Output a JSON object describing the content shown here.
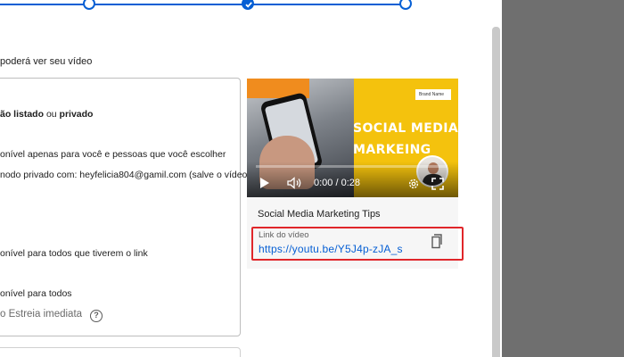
{
  "visibility": {
    "subtitle": "poderá ver seu vídeo",
    "private_heading_a": "ão listado",
    "private_heading_or": "ou",
    "private_heading_b": "privado",
    "private_desc": "onível apenas para você e pessoas que você escolher",
    "private_share": "nodo privado com: heyfelicia804@gamil.com (salve o vídeo",
    "unlisted_desc": "onível para todos que tiverem o link",
    "public_desc": "onível para todos",
    "premiere_label": "o Estreia imediata",
    "help_glyph": "?"
  },
  "preview": {
    "thumbnail_line1": "SOCIAL MEDIA",
    "thumbnail_line2": "MARKEING",
    "brand_label": "Brand Name",
    "time": "0:00 / 0:28",
    "progress_fraction": 0.0,
    "video_title": "Social Media Marketing Tips",
    "link_label": "Link do vídeo",
    "link_url": "https://youtu.be/Y5J4p-zJA_s"
  },
  "colors": {
    "accent": "#065fd4",
    "highlight_box": "#e0262a",
    "thumbnail_yellow": "#f4c20d",
    "backdrop": "#6f6f6f"
  },
  "icons": [
    "check-icon",
    "help-icon",
    "play-icon",
    "volume-icon",
    "settings-icon",
    "fullscreen-icon",
    "copy-icon"
  ]
}
